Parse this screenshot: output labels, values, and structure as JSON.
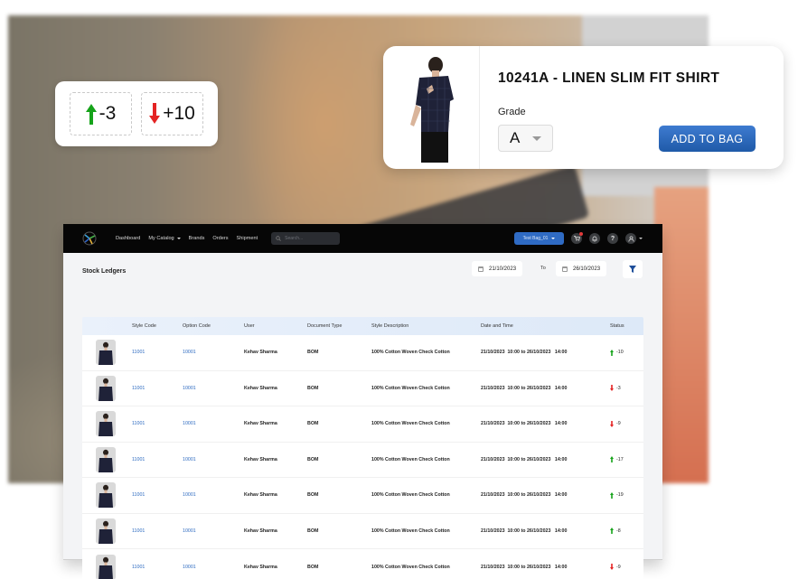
{
  "stock_chips": [
    {
      "direction": "up",
      "color": "#16a31a",
      "value": "-3"
    },
    {
      "direction": "down",
      "color": "#e42323",
      "value": "+10"
    }
  ],
  "product_card": {
    "title": "10241A - LINEN SLIM FIT SHIRT",
    "grade_label": "Grade",
    "grade_value": "A",
    "add_button": "ADD TO BAG",
    "button_color": "#2a66b8"
  },
  "navbar": {
    "items": [
      {
        "label": "Dashboard",
        "dropdown": false
      },
      {
        "label": "My Catalog",
        "dropdown": true
      },
      {
        "label": "Brands",
        "dropdown": false
      },
      {
        "label": "Orders",
        "dropdown": false
      },
      {
        "label": "Shipment",
        "dropdown": false
      }
    ],
    "search_placeholder": "Search...",
    "store_selector": "Test Bag_01",
    "icons": [
      "cart-icon",
      "bell-icon",
      "help-icon",
      "user-icon"
    ]
  },
  "page": {
    "title": "Stock Ledgers",
    "date_from": "21/10/2023",
    "to_label": "To",
    "date_to": "26/10/2023"
  },
  "table": {
    "columns": [
      "",
      "Style Code",
      "Option Code",
      "User",
      "Document Type",
      "Style Description",
      "Date and Time",
      "Status"
    ],
    "rows": [
      {
        "style_code": "11001",
        "option_code": "10001",
        "user": "Kehav Sharma",
        "doc_type": "BOM",
        "description": "100% Cotton Woven Check Cotton",
        "datetime": "21/10/2023  10:00 to 26/10/2023   14:00",
        "status_dir": "up",
        "status_value": "-10"
      },
      {
        "style_code": "11001",
        "option_code": "10001",
        "user": "Kehav Sharma",
        "doc_type": "BOM",
        "description": "100% Cotton Woven Check Cotton",
        "datetime": "21/10/2023  10:00 to 26/10/2023   14:00",
        "status_dir": "down",
        "status_value": "-3"
      },
      {
        "style_code": "11001",
        "option_code": "10001",
        "user": "Kehav Sharma",
        "doc_type": "BOM",
        "description": "100% Cotton Woven Check Cotton",
        "datetime": "21/10/2023  10:00 to 26/10/2023   14:00",
        "status_dir": "down",
        "status_value": "-9"
      },
      {
        "style_code": "11001",
        "option_code": "10001",
        "user": "Kehav Sharma",
        "doc_type": "BOM",
        "description": "100% Cotton Woven Check Cotton",
        "datetime": "21/10/2023  10:00 to 26/10/2023   14:00",
        "status_dir": "up",
        "status_value": "-17"
      },
      {
        "style_code": "11001",
        "option_code": "10001",
        "user": "Kehav Sharma",
        "doc_type": "BOM",
        "description": "100% Cotton Woven Check Cotton",
        "datetime": "21/10/2023  10:00 to 26/10/2023   14:00",
        "status_dir": "up",
        "status_value": "-19"
      },
      {
        "style_code": "11001",
        "option_code": "10001",
        "user": "Kehav Sharma",
        "doc_type": "BOM",
        "description": "100% Cotton Woven Check Cotton",
        "datetime": "21/10/2023  10:00 to 26/10/2023   14:00",
        "status_dir": "up",
        "status_value": "-8"
      },
      {
        "style_code": "11001",
        "option_code": "10001",
        "user": "Kehav Sharma",
        "doc_type": "BOM",
        "description": "100% Cotton Woven Check Cotton",
        "datetime": "21/10/2023  10:00 to 26/10/2023   14:00",
        "status_dir": "down",
        "status_value": "-9"
      }
    ]
  },
  "colors": {
    "up": "#16a31a",
    "down": "#e42323",
    "link": "#2e6bc1",
    "navbar": "#060606"
  }
}
